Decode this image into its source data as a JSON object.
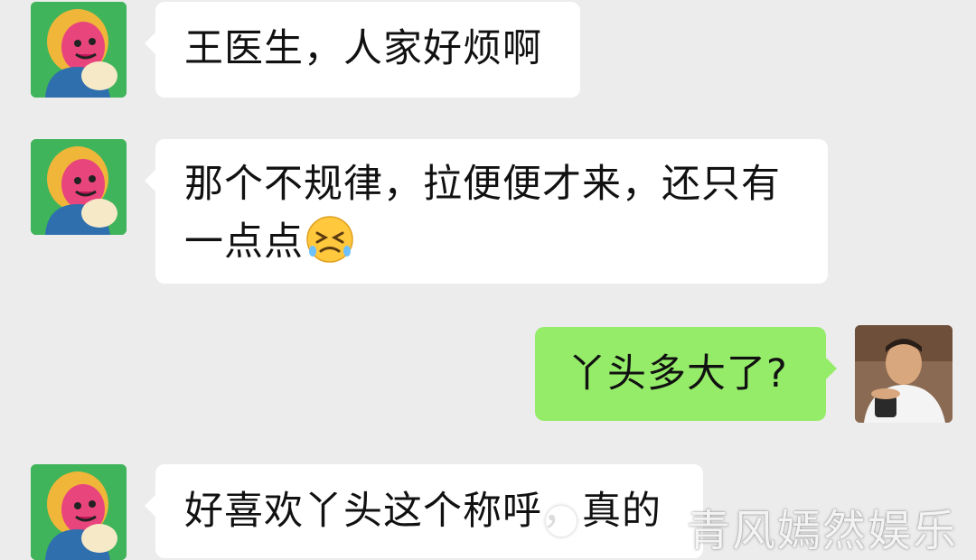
{
  "messages": [
    {
      "sender": "left",
      "lines": [
        "王医生，人家好烦啊"
      ]
    },
    {
      "sender": "left",
      "lines": [
        "那个不规律，拉便便才来，还只有",
        "一点点"
      ],
      "emoji": "persevering-face-emoji"
    },
    {
      "sender": "right",
      "lines": [
        "丫头多大了?"
      ]
    },
    {
      "sender": "left",
      "lines": [
        "好喜欢丫头这个称呼，真的"
      ]
    }
  ],
  "watermark": "青风嫣然娱乐",
  "colors": {
    "background": "#ececec",
    "left_bubble": "#ffffff",
    "right_bubble": "#95ec69",
    "left_avatar_bg": "#3fb45a"
  },
  "icons": {
    "left_avatar": "cartoon-girl-avatar",
    "right_avatar": "doctor-photo-avatar"
  }
}
